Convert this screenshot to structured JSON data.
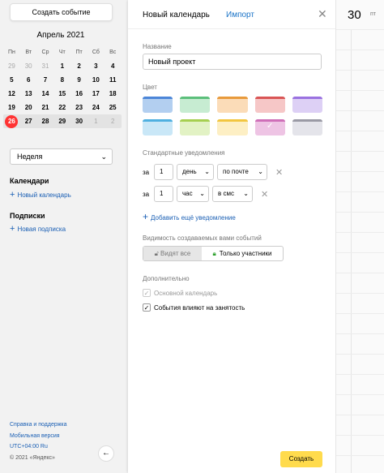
{
  "sidebar": {
    "create_label": "Создать событие",
    "month_title": "Апрель 2021",
    "weekdays": [
      "Пн",
      "Вт",
      "Ср",
      "Чт",
      "Пт",
      "Сб",
      "Вс"
    ],
    "weeks": [
      [
        "29",
        "30",
        "31",
        "1",
        "2",
        "3",
        "4"
      ],
      [
        "5",
        "6",
        "7",
        "8",
        "9",
        "10",
        "11"
      ],
      [
        "12",
        "13",
        "14",
        "15",
        "16",
        "17",
        "18"
      ],
      [
        "19",
        "20",
        "21",
        "22",
        "23",
        "24",
        "25"
      ],
      [
        "26",
        "27",
        "28",
        "29",
        "30",
        "1",
        "2"
      ]
    ],
    "today": "26",
    "view_value": "Неделя",
    "calendars_heading": "Календари",
    "new_calendar_link": "Новый календарь",
    "subscriptions_heading": "Подписки",
    "new_subscription_link": "Новая подписка",
    "help_link": "Справка и поддержка",
    "mobile_link": "Мобильная версия",
    "tz_lang": "UTC+04:00  Ru",
    "copyright": "© 2021 «Яндекс»"
  },
  "panel": {
    "tab_new": "Новый календарь",
    "tab_import": "Импорт",
    "name_label": "Название",
    "name_value": "Новый проект",
    "color_label": "Цвет",
    "swatches": [
      [
        {
          "fill": "#b3cff0",
          "top": "#4c86d8"
        },
        {
          "fill": "#c7ecd2",
          "top": "#5cbf7b"
        },
        {
          "fill": "#fbdcb8",
          "top": "#e89a3c"
        },
        {
          "fill": "#f6c7c7",
          "top": "#d95555"
        },
        {
          "fill": "#ddd0f5",
          "top": "#9a72e0"
        }
      ],
      [
        {
          "fill": "#c9e7f7",
          "top": "#4fb0e0"
        },
        {
          "fill": "#e2f2c4",
          "top": "#a6cf50"
        },
        {
          "fill": "#fdefc4",
          "top": "#f2c640"
        },
        {
          "fill": "#eec4e4",
          "top": "#cf6fb8"
        },
        {
          "fill": "#e4e4ea",
          "top": "#9a9aa5"
        }
      ]
    ],
    "selected_swatch": "1.3",
    "notif_label": "Стандартные уведомления",
    "notifications": [
      {
        "prefix": "за",
        "amount": "1",
        "unit": "день",
        "channel": "по почте"
      },
      {
        "prefix": "за",
        "amount": "1",
        "unit": "час",
        "channel": "в смс"
      }
    ],
    "add_notif": "Добавить ещё уведомление",
    "visibility_label": "Видимость создаваемых вами событий",
    "visibility_all": "Видят все",
    "visibility_members": "Только участники",
    "extra_label": "Дополнительно",
    "main_calendar": "Основной календарь",
    "affects_busy": "События влияют на занятость",
    "submit": "Создать"
  },
  "day": {
    "number": "30",
    "weekday": "пт"
  }
}
